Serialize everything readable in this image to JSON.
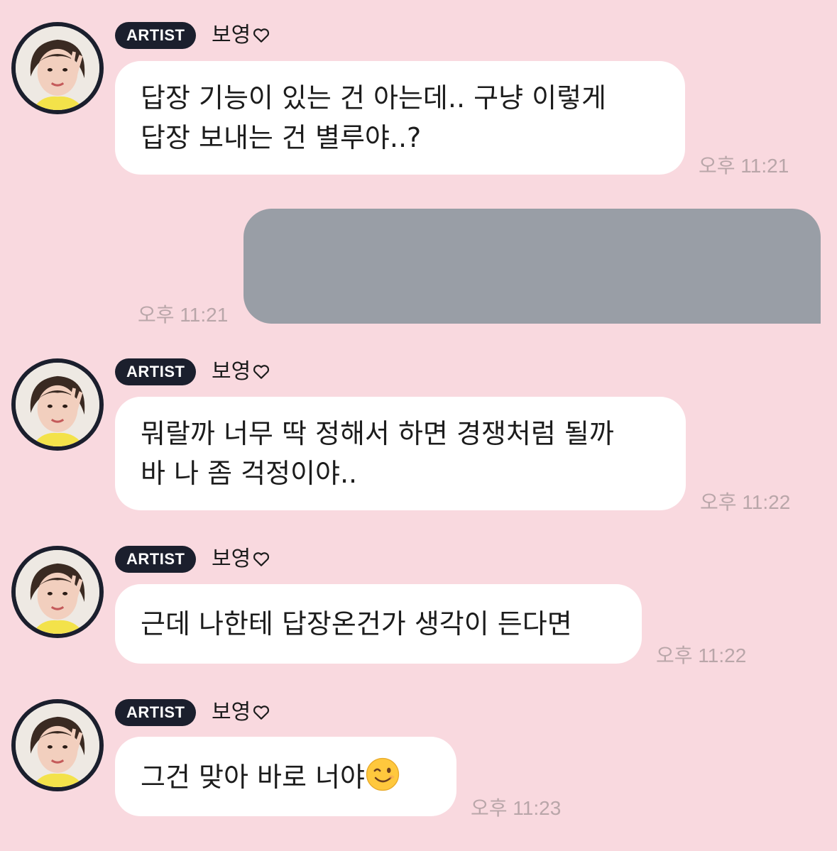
{
  "messages": [
    {
      "badge": "ARTIST",
      "sender": "보영",
      "lines": [
        "답장 기능이 있는 건 아는데.. 구냥 이렇게",
        "답장 보내는 건 별루야..?"
      ],
      "time": "오후 11:21"
    },
    {
      "outgoing": true,
      "time": "오후 11:21"
    },
    {
      "badge": "ARTIST",
      "sender": "보영",
      "lines": [
        "뭐랄까 너무 딱 정해서 하면 경쟁처럼 될까",
        "바 나 좀 걱정이야.."
      ],
      "time": "오후 11:22"
    },
    {
      "badge": "ARTIST",
      "sender": "보영",
      "lines": [
        "근데 나한테 답장온건가 생각이 든다면"
      ],
      "time": "오후 11:22"
    },
    {
      "badge": "ARTIST",
      "sender": "보영",
      "lines": [
        "그건 맞아 바로 너야"
      ],
      "emoji": "winking-face-emoji",
      "time": "오후 11:23"
    }
  ],
  "colors": {
    "background": "#f9d9df",
    "bubble": "#ffffff",
    "badge": "#1b1f2d",
    "outgoing_bubble": "#999ea6",
    "timestamp": "#b9a6a9"
  }
}
